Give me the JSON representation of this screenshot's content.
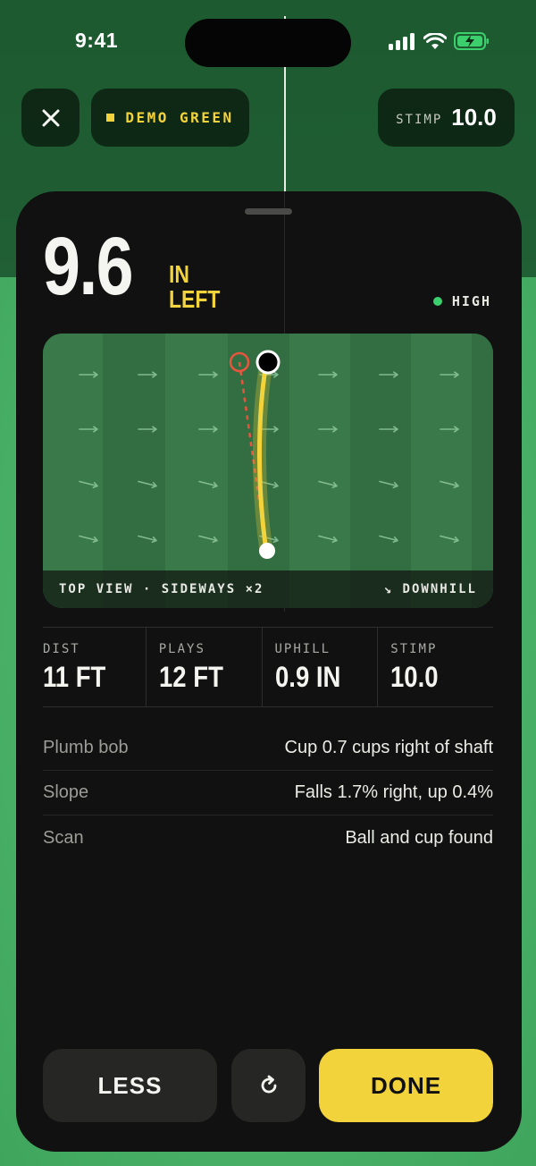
{
  "status": {
    "time": "9:41"
  },
  "top": {
    "course": "DEMO GREEN",
    "stimp_label": "STIMP",
    "stimp_value": "10.0"
  },
  "result": {
    "break_value": "9.6",
    "break_unit": "IN",
    "break_dir": "LEFT",
    "confidence": "HIGH"
  },
  "map": {
    "footer_left": "TOP VIEW · SIDEWAYS ×2",
    "footer_right": "↘ DOWNHILL"
  },
  "stats": [
    {
      "label": "DIST",
      "value": "11 FT"
    },
    {
      "label": "PLAYS",
      "value": "12 FT"
    },
    {
      "label": "UPHILL",
      "value": "0.9 IN"
    },
    {
      "label": "STIMP",
      "value": "10.0"
    }
  ],
  "details": [
    {
      "label": "Plumb bob",
      "value": "Cup 0.7 cups right of shaft"
    },
    {
      "label": "Slope",
      "value": "Falls 1.7% right, up 0.4%"
    },
    {
      "label": "Scan",
      "value": "Ball and cup found"
    }
  ],
  "actions": {
    "less": "LESS",
    "done": "DONE"
  },
  "colors": {
    "accent": "#f2d33b",
    "confidence": "#3ccf6e",
    "sheet": "#101110",
    "miss_line": "#e8553e"
  },
  "icons": [
    "close-icon",
    "refresh-icon",
    "signal-icon",
    "wifi-icon",
    "battery-charging-icon",
    "slope-arrow-icon"
  ]
}
